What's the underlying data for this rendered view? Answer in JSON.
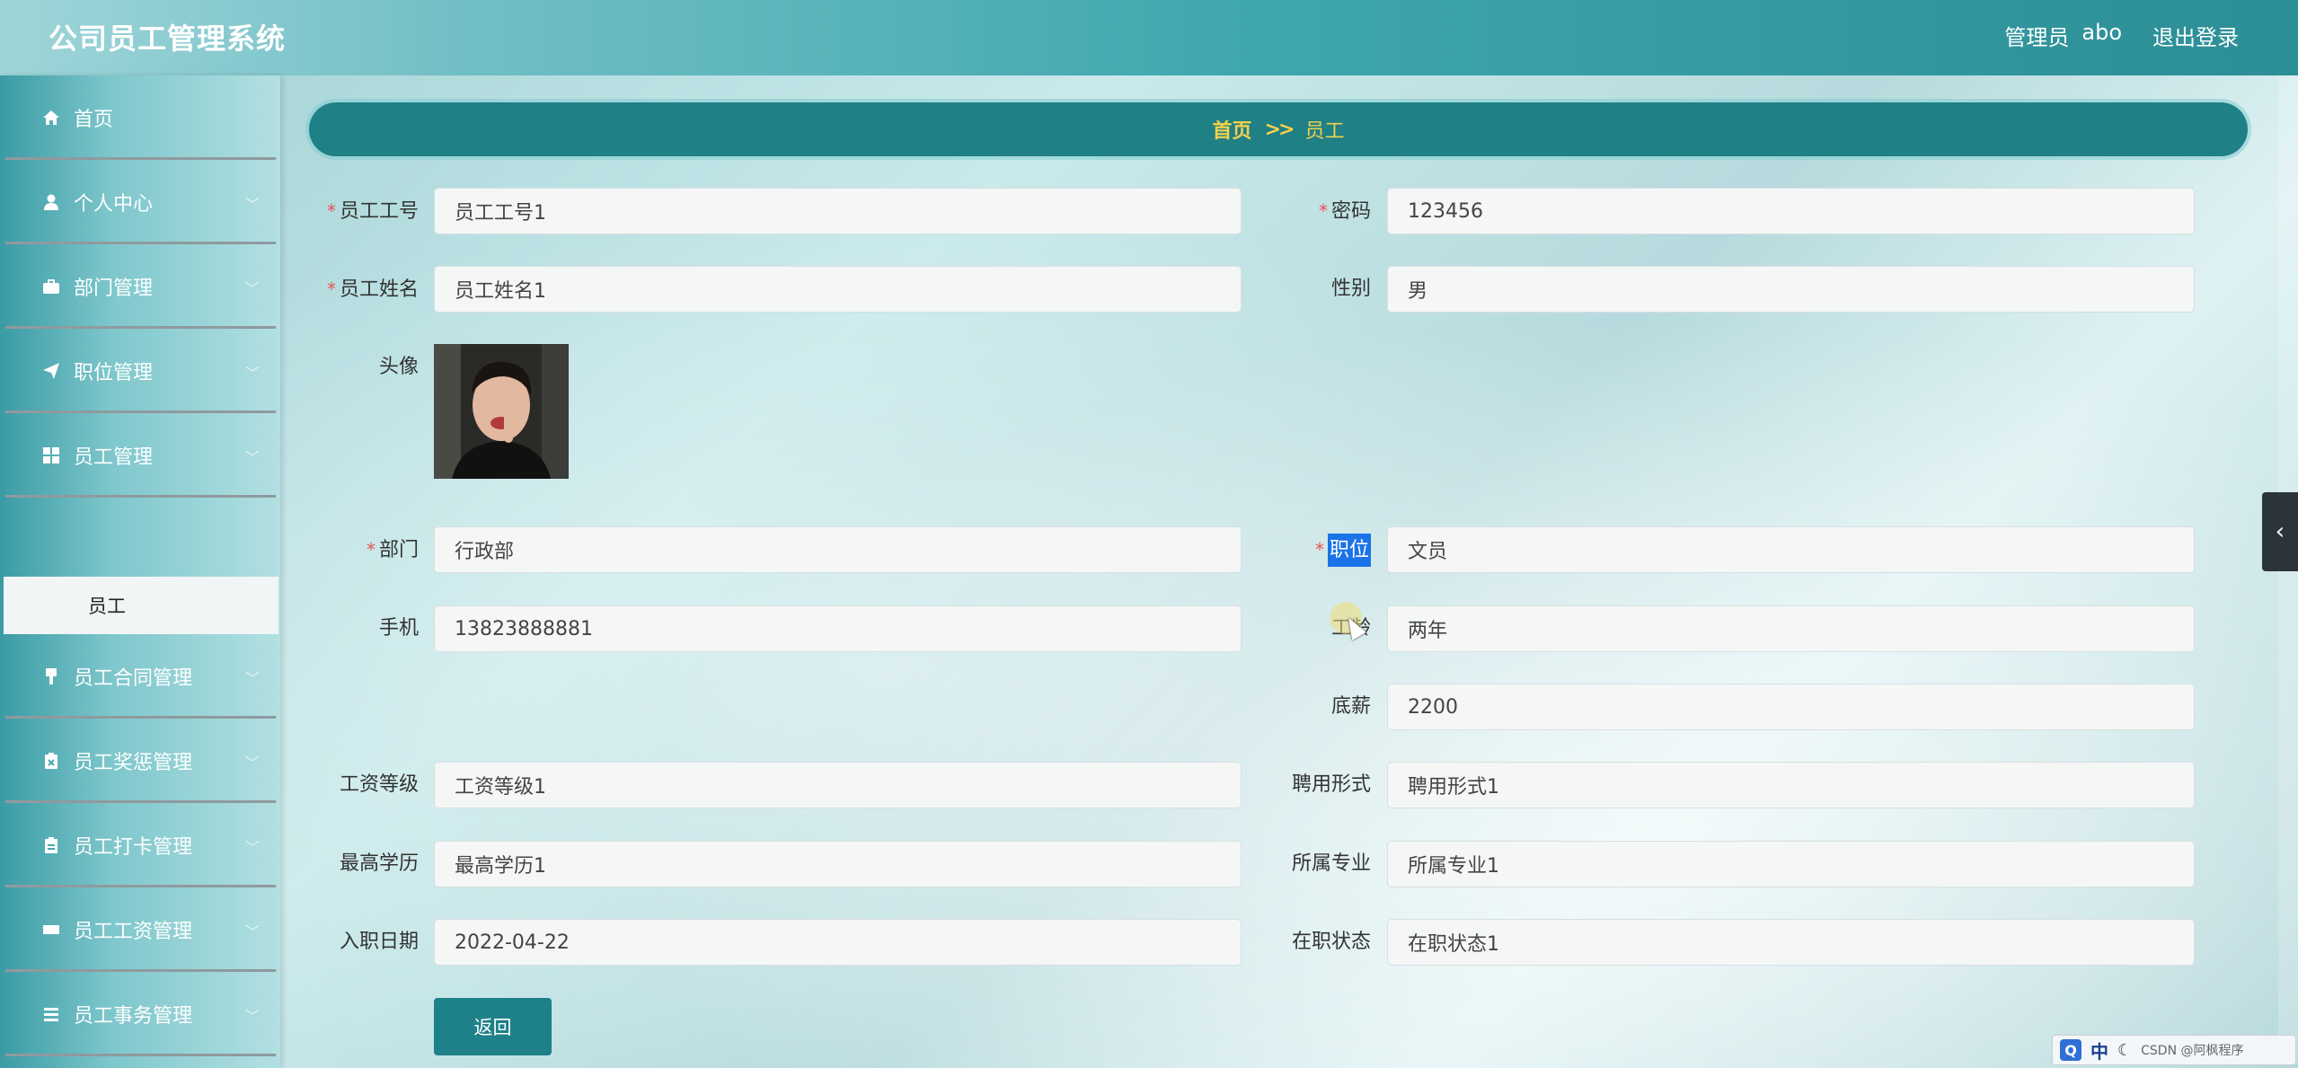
{
  "header": {
    "app_title": "公司员工管理系统",
    "role_label": "管理员",
    "username": "abo",
    "logout_label": "退出登录"
  },
  "sidebar": {
    "items": [
      {
        "label": "首页",
        "icon": "home-icon"
      },
      {
        "label": "个人中心",
        "icon": "user-icon"
      },
      {
        "label": "部门管理",
        "icon": "briefcase-icon"
      },
      {
        "label": "职位管理",
        "icon": "send-icon"
      },
      {
        "label": "员工管理",
        "icon": "grid-icon"
      },
      {
        "label": "员工合同管理",
        "icon": "brush-icon"
      },
      {
        "label": "员工奖惩管理",
        "icon": "clipboard-x-icon"
      },
      {
        "label": "员工打卡管理",
        "icon": "clipboard-icon"
      },
      {
        "label": "员工工资管理",
        "icon": "ticket-icon"
      },
      {
        "label": "员工事务管理",
        "icon": "list-icon"
      }
    ],
    "sub_item": "员工"
  },
  "breadcrumb": {
    "home": "首页",
    "sep": ">>",
    "current": "员工"
  },
  "form": {
    "employee_no": {
      "label": "员工工号",
      "value": "员工工号1"
    },
    "password": {
      "label": "密码",
      "value": "123456"
    },
    "employee_name": {
      "label": "员工姓名",
      "value": "员工姓名1"
    },
    "gender": {
      "label": "性别",
      "value": "男"
    },
    "avatar": {
      "label": "头像"
    },
    "department": {
      "label": "部门",
      "value": "行政部"
    },
    "position": {
      "label": "职位",
      "value": "文员"
    },
    "phone": {
      "label": "手机",
      "value": "13823888881"
    },
    "seniority": {
      "label": "工龄",
      "value": "两年"
    },
    "base_salary": {
      "label": "底薪",
      "value": "2200"
    },
    "salary_grade": {
      "label": "工资等级",
      "value": "工资等级1"
    },
    "employment_type": {
      "label": "聘用形式",
      "value": "聘用形式1"
    },
    "education": {
      "label": "最高学历",
      "value": "最高学历1"
    },
    "major": {
      "label": "所属专业",
      "value": "所属专业1"
    },
    "hire_date": {
      "label": "入职日期",
      "value": "2022-04-22"
    },
    "job_status": {
      "label": "在职状态",
      "value": "在职状态1"
    },
    "back_label": "返回"
  },
  "ime": {
    "q": "Q",
    "zh": "中",
    "text": "CSDN @阿枫程序"
  },
  "colors": {
    "primary": "#1e8088",
    "breadcrumb_text": "#f2d14b",
    "required": "#e85454"
  }
}
